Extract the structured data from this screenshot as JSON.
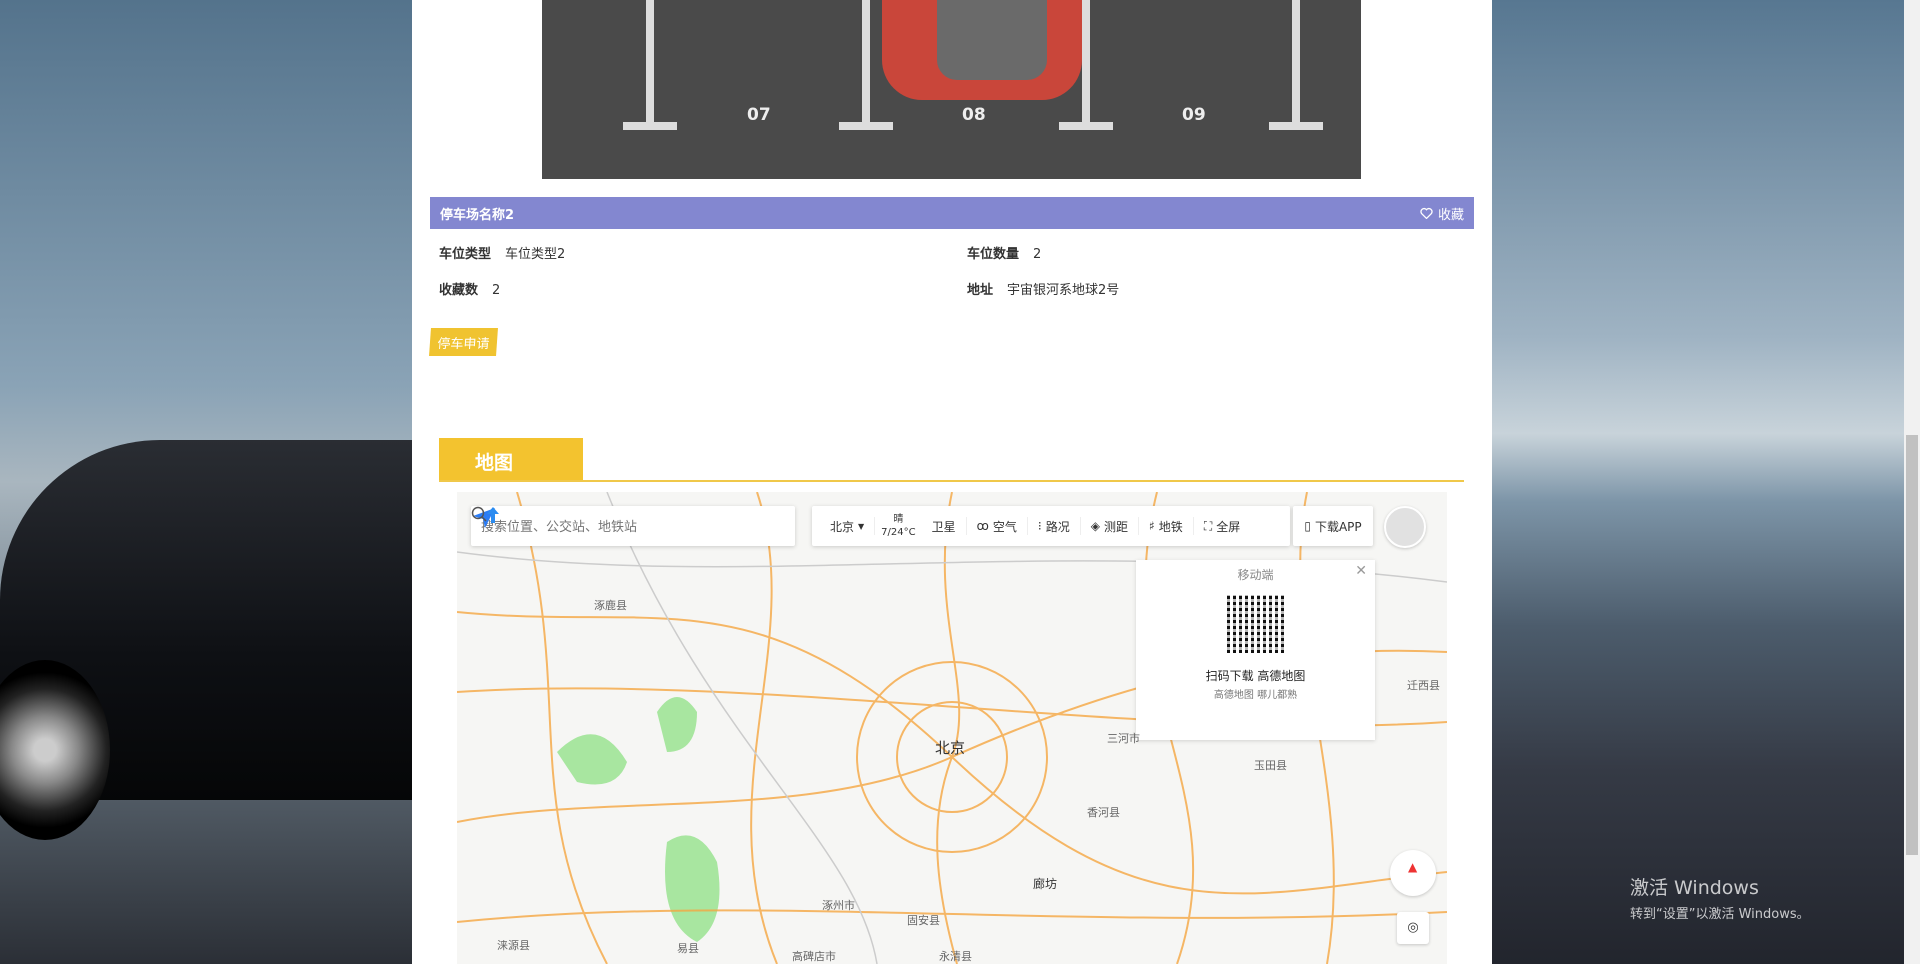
{
  "photo": {
    "slot_numbers": [
      "07",
      "08",
      "09"
    ]
  },
  "parking": {
    "name": "停车场名称2",
    "favorite_label": "收藏",
    "fields": [
      {
        "label": "车位类型",
        "value": "车位类型2"
      },
      {
        "label": "车位数量",
        "value": "2"
      },
      {
        "label": "收藏数",
        "value": "2"
      },
      {
        "label": "地址",
        "value": "宇宙银河系地球2号"
      }
    ],
    "apply_label": "停车申请"
  },
  "map_section": {
    "tab_label": "地图"
  },
  "map": {
    "search_placeholder": "搜索位置、公交站、地铁站",
    "city": "北京",
    "weather": "晴",
    "temperature": "7/24°C",
    "tools": [
      {
        "icon": "satellite-icon",
        "label": "卫星"
      },
      {
        "icon": "air-icon",
        "label": "空气"
      },
      {
        "icon": "traffic-icon",
        "label": "路况"
      },
      {
        "icon": "ruler-icon",
        "label": "测距"
      },
      {
        "icon": "subway-icon",
        "label": "地铁"
      },
      {
        "icon": "fullscreen-icon",
        "label": "全屏"
      }
    ],
    "download_label": "下载APP",
    "popup": {
      "title": "移动端",
      "caption": "扫码下载 高德地图",
      "subcaption": "高德地图 哪儿都熟"
    },
    "places": [
      "涿鹿县",
      "北京",
      "三河市",
      "玉田县",
      "香河县",
      "廊坊",
      "涿州市",
      "固安县",
      "涞源县",
      "易县",
      "高碑店市",
      "永清县",
      "迁西县"
    ],
    "colors": {
      "roads": "#f5a742",
      "green": "#a8e6a0"
    }
  },
  "watermark": {
    "line1": "激活 Windows",
    "line2": "转到“设置”以激活 Windows。"
  },
  "colors": {
    "title_bar": "#8387d0",
    "accent": "#f3c32f"
  }
}
